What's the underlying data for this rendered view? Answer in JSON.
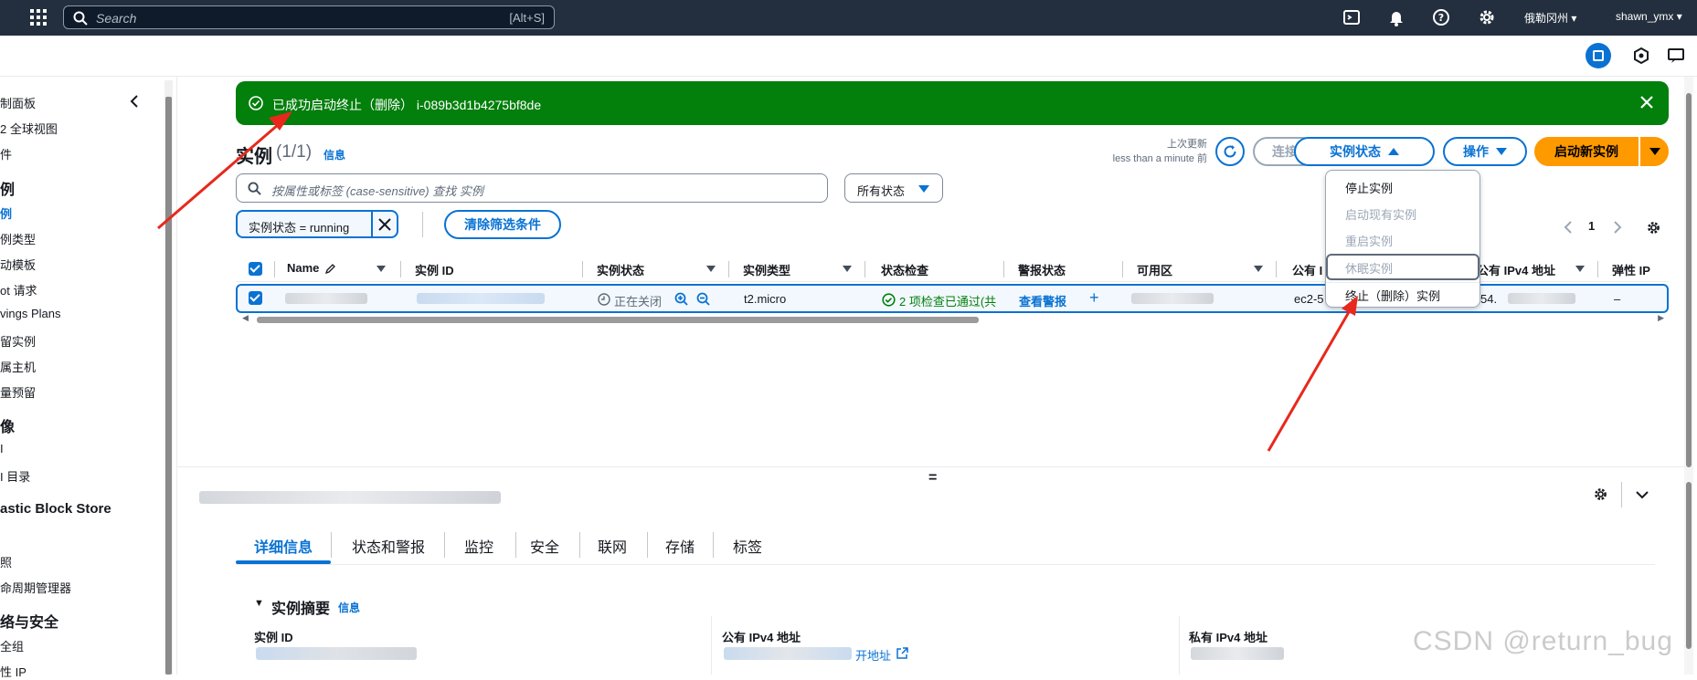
{
  "topbar": {
    "search_placeholder": "Search",
    "search_shortcut": "[Alt+S]",
    "region": "俄勒冈州",
    "user": "shawn_ymx"
  },
  "sidebar": {
    "items": [
      {
        "label": "制面板",
        "kind": "item"
      },
      {
        "label": "2 全球视图",
        "kind": "item"
      },
      {
        "label": "件",
        "kind": "item"
      },
      {
        "label": "例",
        "kind": "head"
      },
      {
        "label": "例",
        "kind": "active"
      },
      {
        "label": "例类型",
        "kind": "item"
      },
      {
        "label": "动模板",
        "kind": "item"
      },
      {
        "label": "ot 请求",
        "kind": "item"
      },
      {
        "label": "vings Plans",
        "kind": "item"
      },
      {
        "label": "留实例",
        "kind": "item"
      },
      {
        "label": "属主机",
        "kind": "item"
      },
      {
        "label": "量预留",
        "kind": "item"
      },
      {
        "label": "像",
        "kind": "head"
      },
      {
        "label": "I",
        "kind": "item"
      },
      {
        "label": "I 目录",
        "kind": "item"
      },
      {
        "label": "astic Block Store",
        "kind": "head"
      },
      {
        "label": "照",
        "kind": "item"
      },
      {
        "label": "命周期管理器",
        "kind": "item"
      },
      {
        "label": "络与安全",
        "kind": "head"
      },
      {
        "label": "全组",
        "kind": "item"
      },
      {
        "label": "性 IP",
        "kind": "item"
      }
    ]
  },
  "flash": {
    "message": "已成功启动终止（删除） i-089b3d1b4275bf8de"
  },
  "header": {
    "title": "实例",
    "count": "(1/1)",
    "info": "信息",
    "last_updated_label": "上次更新",
    "last_updated_value": "less than a minute 前",
    "connect": "连接",
    "instance_state": "实例状态",
    "actions": "操作",
    "launch": "启动新实例"
  },
  "filter": {
    "placeholder": "按属性或标签 (case-sensitive) 查找 实例",
    "state_select": "所有状态",
    "token": "实例状态 = running",
    "clear": "清除筛选条件"
  },
  "pager": {
    "page": "1"
  },
  "table": {
    "columns": [
      "Name",
      "实例 ID",
      "实例状态",
      "实例类型",
      "状态检查",
      "警报状态",
      "可用区",
      "公有 I",
      "公有 IPv4 地址",
      "弹性 IP"
    ],
    "row": {
      "state": "正在关闭",
      "type": "t2.micro",
      "check": "2 项检查已通过(共",
      "alarm": "查看警报",
      "dns": "ec2-5",
      "ip": "54.",
      "eip": "–"
    }
  },
  "dropdown": {
    "items": [
      {
        "label": "停止实例",
        "disabled": false
      },
      {
        "label": "启动现有实例",
        "disabled": true
      },
      {
        "label": "重启实例",
        "disabled": true
      },
      {
        "label": "休眠实例",
        "disabled": true
      },
      {
        "label": "终止（删除）实例",
        "disabled": false
      }
    ]
  },
  "detail": {
    "tabs": [
      "详细信息",
      "状态和警报",
      "监控",
      "安全",
      "联网",
      "存储",
      "标签"
    ],
    "summary_title": "实例摘要",
    "summary_info": "信息",
    "instance_id_label": "实例 ID",
    "public_ip_label": "公有 IPv4 地址",
    "public_ip_link": "开地址",
    "private_ip_label": "私有 IPv4 地址"
  },
  "watermark": "CSDN @return_bug",
  "colors": {
    "accent": "#0972d3",
    "success": "#037f0c",
    "primary_button": "#ff9900",
    "topbar": "#232f3e",
    "annotation_arrow": "#e8281c"
  }
}
